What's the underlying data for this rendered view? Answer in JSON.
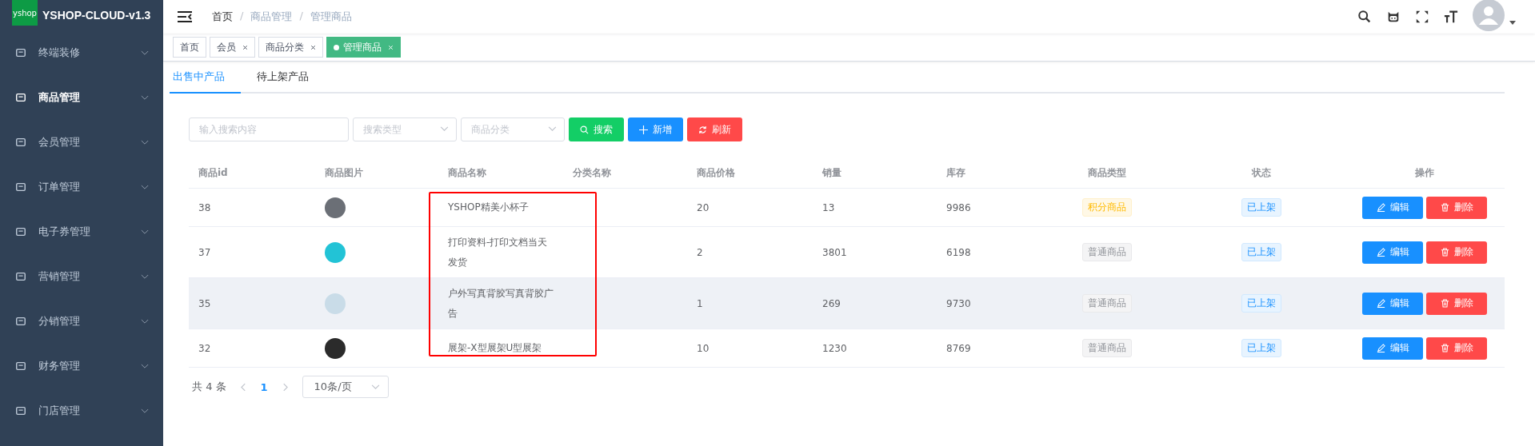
{
  "brand": {
    "logo_text": "yshop",
    "title": "YSHOP-CLOUD-v1.3"
  },
  "sidebar": {
    "items": [
      {
        "label": "终端装修",
        "selected": false
      },
      {
        "label": "商品管理",
        "selected": true
      },
      {
        "label": "会员管理",
        "selected": false
      },
      {
        "label": "订单管理",
        "selected": false
      },
      {
        "label": "电子券管理",
        "selected": false
      },
      {
        "label": "营销管理",
        "selected": false
      },
      {
        "label": "分销管理",
        "selected": false
      },
      {
        "label": "财务管理",
        "selected": false
      },
      {
        "label": "门店管理",
        "selected": false
      }
    ]
  },
  "breadcrumb": [
    {
      "label": "首页",
      "current": false
    },
    {
      "separator": "/",
      "label": "商品管理",
      "current": true
    },
    {
      "separator": "/",
      "label": "管理商品",
      "current": true
    }
  ],
  "tags": [
    {
      "label": "首页",
      "selected": false,
      "closable": false
    },
    {
      "label": "会员",
      "selected": false,
      "closable": true
    },
    {
      "label": "商品分类",
      "selected": false,
      "closable": true
    },
    {
      "label": "管理商品",
      "selected": true,
      "closable": true
    }
  ],
  "tabs": [
    {
      "label": "出售中产品",
      "selected": true
    },
    {
      "label": "待上架产品",
      "selected": false
    }
  ],
  "filters": {
    "search_placeholder": "输入搜索内容",
    "type_placeholder": "搜索类型",
    "category_placeholder": "商品分类"
  },
  "buttons": [
    {
      "label": "搜索",
      "kind": "search"
    },
    {
      "label": "新增",
      "kind": "add"
    },
    {
      "label": "刷新",
      "kind": "refresh"
    }
  ],
  "table": {
    "columns": [
      "商品id",
      "商品图片",
      "商品名称",
      "分类名称",
      "商品价格",
      "销量",
      "库存",
      "商品类型",
      "状态",
      "操作"
    ],
    "rows": [
      {
        "id": "38",
        "name": "YSHOP精美小杯子",
        "price": "20",
        "sales": "13",
        "stock": "9986",
        "type": {
          "label": "积分商品",
          "kind": "points"
        },
        "status": "已上架",
        "actions": [
          "编辑",
          "删除"
        ],
        "hovered": false
      },
      {
        "id": "37",
        "name": "打印资料-打印文档当天发货",
        "price": "2",
        "sales": "3801",
        "stock": "6198",
        "type": {
          "label": "普通商品",
          "kind": "normal"
        },
        "status": "已上架",
        "actions": [
          "编辑",
          "删除"
        ],
        "hovered": false
      },
      {
        "id": "35",
        "name": "户外写真背胶写真背胶广告",
        "price": "1",
        "sales": "269",
        "stock": "9730",
        "type": {
          "label": "普通商品",
          "kind": "normal"
        },
        "status": "已上架",
        "actions": [
          "编辑",
          "删除"
        ],
        "hovered": true
      },
      {
        "id": "32",
        "name": "展架-X型展架U型展架",
        "price": "10",
        "sales": "1230",
        "stock": "8769",
        "type": {
          "label": "普通商品",
          "kind": "normal"
        },
        "status": "已上架",
        "actions": [
          "编辑",
          "删除"
        ],
        "hovered": false
      }
    ]
  },
  "pagination": {
    "total": "共 4 条",
    "page": "1",
    "page_size": "10条/页"
  }
}
